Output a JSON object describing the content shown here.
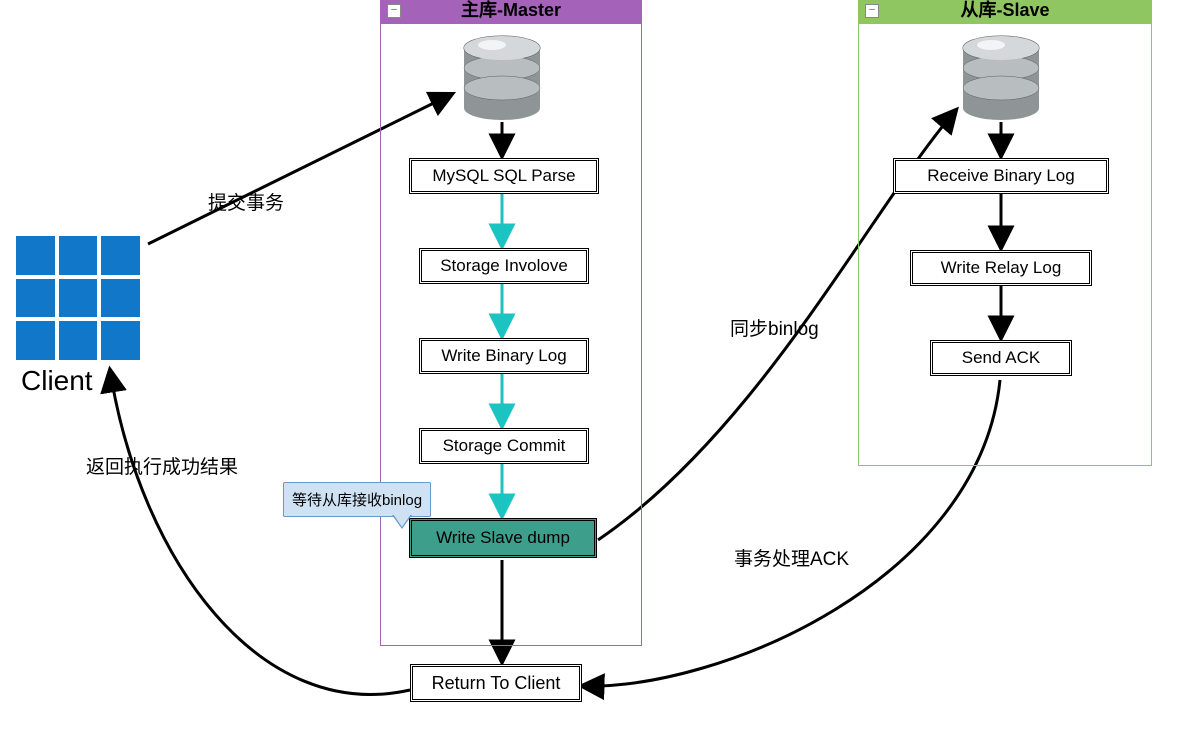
{
  "client": {
    "label": "Client"
  },
  "master": {
    "title": "主库-Master",
    "steps": {
      "parse": "MySQL SQL Parse",
      "involove": "Storage Involove",
      "wbl": "Write Binary Log",
      "commit": "Storage Commit",
      "dump": "Write Slave dump"
    },
    "callout": "等待从库接收binlog",
    "return": "Return To Client"
  },
  "slave": {
    "title": "从库-Slave",
    "steps": {
      "recv": "Receive Binary Log",
      "relay": "Write Relay Log",
      "ack": "Send ACK"
    }
  },
  "edges": {
    "submit": "提交事务",
    "return_result": "返回执行成功结果",
    "sync_binlog": "同步binlog",
    "ack": "事务处理ACK"
  }
}
